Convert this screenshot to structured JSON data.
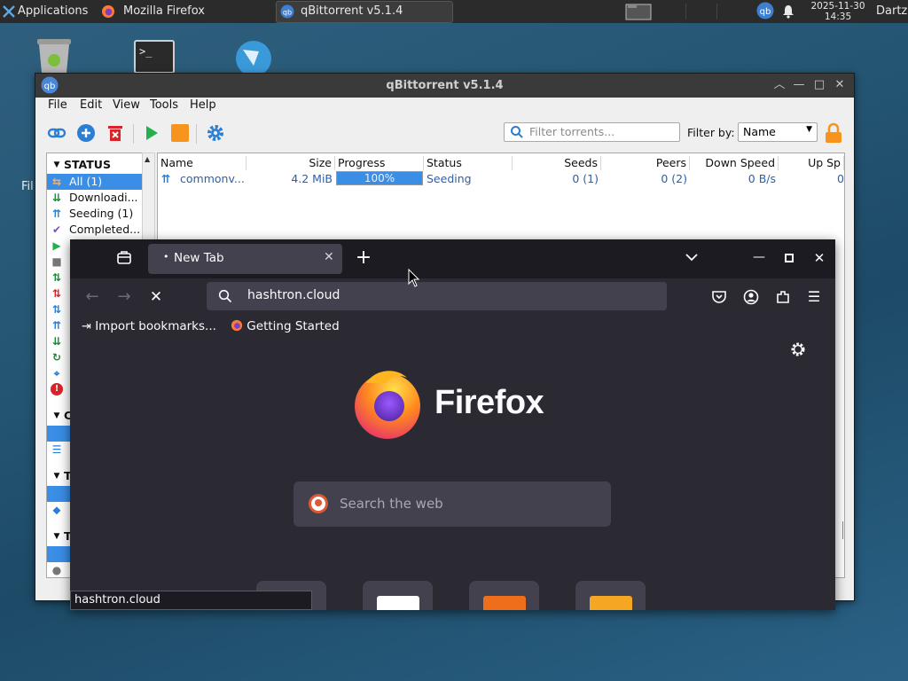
{
  "taskbar": {
    "apps_label": "Applications",
    "tasks": [
      {
        "label": "Mozilla Firefox",
        "icon": "firefox-icon"
      },
      {
        "label": "qBittorrent v5.1.4",
        "icon": "qbittorrent-icon"
      }
    ],
    "clock_date": "2025-11-30",
    "clock_time": "14:35",
    "user": "Dartz"
  },
  "desktop": {
    "partial_label": "Fil"
  },
  "qbittorrent": {
    "title": "qBittorrent v5.1.4",
    "menu": [
      "File",
      "Edit",
      "View",
      "Tools",
      "Help"
    ],
    "filter_placeholder": "Filter torrents...",
    "filter_by_label": "Filter by:",
    "filter_by_value": "Name",
    "sidebar": {
      "status_header": "STATUS",
      "items": [
        {
          "label": "All (1)",
          "icon": "all-icon",
          "selected": true
        },
        {
          "label": "Downloadi...",
          "icon": "download-icon"
        },
        {
          "label": "Seeding (1)",
          "icon": "seeding-icon"
        },
        {
          "label": "Completed...",
          "icon": "check-icon"
        }
      ],
      "categories_header": "C",
      "tags_header": "T",
      "trackers_header": "T"
    },
    "columns": [
      "Name",
      "Size",
      "Progress",
      "Status",
      "Seeds",
      "Peers",
      "Down Speed",
      "Up Sp"
    ],
    "torrents": [
      {
        "name": "commonv...",
        "size": "4.2 MiB",
        "progress": 100,
        "progress_label": "100%",
        "status": "Seeding",
        "seeds": "0 (1)",
        "peers": "0 (2)",
        "down_speed": "0 B/s",
        "up_speed": "0"
      }
    ]
  },
  "firefox": {
    "tab_title": "New Tab",
    "url": "hashtron.cloud",
    "bookmarks": [
      {
        "label": "Import bookmarks...",
        "icon": "import-icon"
      },
      {
        "label": "Getting Started",
        "icon": "firefox-icon"
      }
    ],
    "brand": "Firefox",
    "search_placeholder": "Search the web",
    "status_url": "hashtron.cloud"
  },
  "colors": {
    "qb_accent": "#3a8ee6",
    "ff_bg": "#2b2a33",
    "ff_tabbar": "#1c1b22"
  }
}
